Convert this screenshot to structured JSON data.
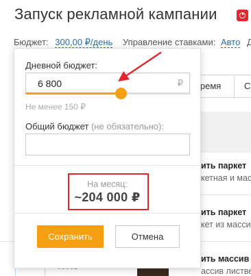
{
  "header": {
    "title": "Запуск рекламной кампании",
    "badge_icon": "target-icon",
    "budget_label": "Бюджет:",
    "budget_value": "300,00 ₽/день",
    "bids_label": "Управление ставками:",
    "bids_value": "Авто"
  },
  "background": {
    "tab_time": "время",
    "products": [
      {
        "title": "ить паркет",
        "subtitle": "кетная и масс"
      },
      {
        "title": "ить паркет",
        "subtitle": "кет из масси"
      },
      {
        "title": "ить массив",
        "subtitle": "ассив лиственн"
      }
    ],
    "row_id": "63882"
  },
  "budget_popover": {
    "daily_label": "Дневной бюджет:",
    "daily_value": "6 800",
    "currency": "₽",
    "slider_fraction": 0.58,
    "min_hint": "Не менее 150 ₽",
    "total_label": "Общий бюджет",
    "total_optional": "(не обязательно):",
    "total_value": "",
    "monthly_label": "На месяц:",
    "monthly_value": "~204 000 ₽",
    "save_label": "Сохранить",
    "cancel_label": "Отмена"
  },
  "colors": {
    "accent": "#f5a013",
    "annotation": "#e3262d",
    "link": "#2b6cb0"
  }
}
